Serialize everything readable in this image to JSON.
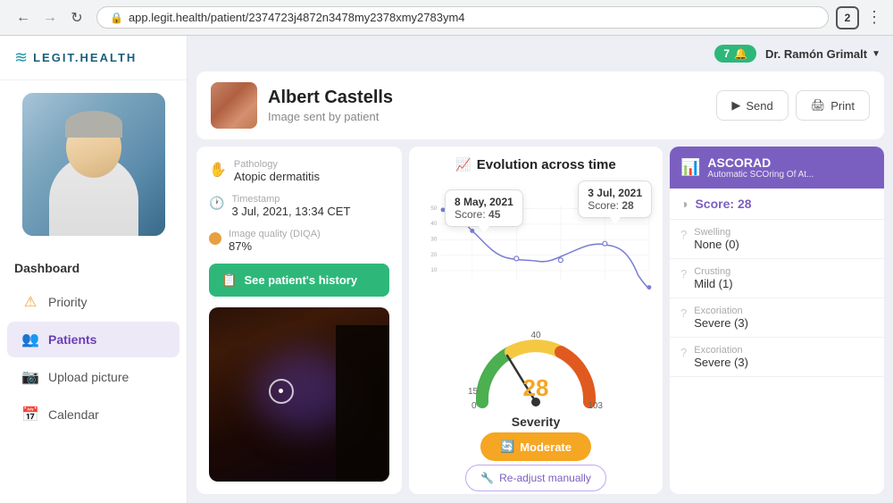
{
  "browser": {
    "url": "app.legit.health/patient/2374723j4872n3478my2378xmy2783ym4",
    "tab_count": "2"
  },
  "header": {
    "notifications": "7",
    "doctor_name": "Dr. Ramón Grimalt"
  },
  "logo": {
    "text": "LEGIT.HEALTH"
  },
  "sidebar": {
    "dashboard_label": "Dashboard",
    "nav_items": [
      {
        "id": "priority",
        "label": "Priority",
        "icon": "⚠"
      },
      {
        "id": "patients",
        "label": "Patients",
        "icon": "👥"
      },
      {
        "id": "upload",
        "label": "Upload picture",
        "icon": "📷"
      },
      {
        "id": "calendar",
        "label": "Calendar",
        "icon": "📅"
      }
    ]
  },
  "patient": {
    "name": "Albert Castells",
    "subtitle": "Image sent by patient",
    "send_label": "Send",
    "print_label": "Print"
  },
  "patient_info": {
    "pathology_label": "Pathology",
    "pathology_value": "Atopic dermatitis",
    "timestamp_label": "Timestamp",
    "timestamp_value": "3 Jul, 2021, 13:34 CET",
    "quality_label": "Image quality (DIQA)",
    "quality_value": "87%",
    "history_button": "See patient's history"
  },
  "chart": {
    "title": "Evolution across time",
    "y_labels": [
      "50",
      "40",
      "30",
      "20",
      "10"
    ],
    "tooltip_left": {
      "date": "8 May, 2021",
      "score_label": "Score:",
      "score_value": "45"
    },
    "tooltip_right": {
      "date": "3 Jul, 2021",
      "score_label": "Score:",
      "score_value": "28"
    }
  },
  "severity": {
    "score": "28",
    "label": "Severity",
    "moderate_label": "Moderate",
    "readjust_label": "Re-adjust manually",
    "gauge_min": "0",
    "gauge_mid1": "15",
    "gauge_mid2": "40",
    "gauge_max": "103"
  },
  "ascorad": {
    "title": "ASCORAD",
    "subtitle": "Automatic SCOring Of At...",
    "score_label": "Score:",
    "score_value": "28",
    "items": [
      {
        "label": "Swelling",
        "value": "None (0)"
      },
      {
        "label": "Crusting",
        "value": "Mild (1)"
      },
      {
        "label": "Excoriation",
        "value": "Severe (3)"
      },
      {
        "label": "Excoriation",
        "value": "Severe (3)"
      }
    ]
  }
}
